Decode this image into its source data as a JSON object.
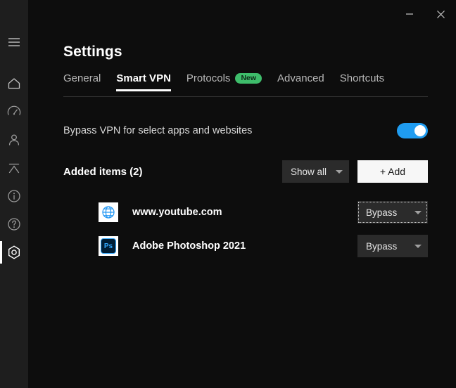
{
  "window": {
    "minimize_label": "minimize",
    "close_label": "close"
  },
  "sidebar": {
    "items": [
      {
        "name": "menu-icon",
        "label": "Menu"
      },
      {
        "name": "home-icon",
        "label": "Home"
      },
      {
        "name": "speedometer-icon",
        "label": "Speed test"
      },
      {
        "name": "account-icon",
        "label": "Account"
      },
      {
        "name": "split-tunnel-icon",
        "label": "Split tunneling"
      },
      {
        "name": "info-icon",
        "label": "Info"
      },
      {
        "name": "help-icon",
        "label": "Help"
      },
      {
        "name": "settings-icon",
        "label": "Settings"
      }
    ],
    "active_index": 7
  },
  "header": {
    "title": "Settings"
  },
  "tabs": [
    {
      "label": "General",
      "active": false,
      "badge": null
    },
    {
      "label": "Smart VPN",
      "active": true,
      "badge": null
    },
    {
      "label": "Protocols",
      "active": false,
      "badge": "New"
    },
    {
      "label": "Advanced",
      "active": false,
      "badge": null
    },
    {
      "label": "Shortcuts",
      "active": false,
      "badge": null
    }
  ],
  "bypass": {
    "label": "Bypass VPN for select apps and websites",
    "toggle_on": true
  },
  "added_items": {
    "title": "Added items (2)",
    "filter_label": "Show all",
    "add_label": "+ Add",
    "rows": [
      {
        "icon": "globe-icon",
        "label": "www.youtube.com",
        "mode": "Bypass",
        "focused": true
      },
      {
        "icon": "photoshop-icon",
        "icon_text": "Ps",
        "label": "Adobe Photoshop 2021",
        "mode": "Bypass",
        "focused": false
      }
    ]
  },
  "colors": {
    "accent_toggle": "#1f9cf0",
    "badge_green": "#3ebd6b",
    "rail_bg": "#1e1e1e",
    "content_bg": "#0d0d0d",
    "photoshop_blue": "#31a8ff"
  }
}
